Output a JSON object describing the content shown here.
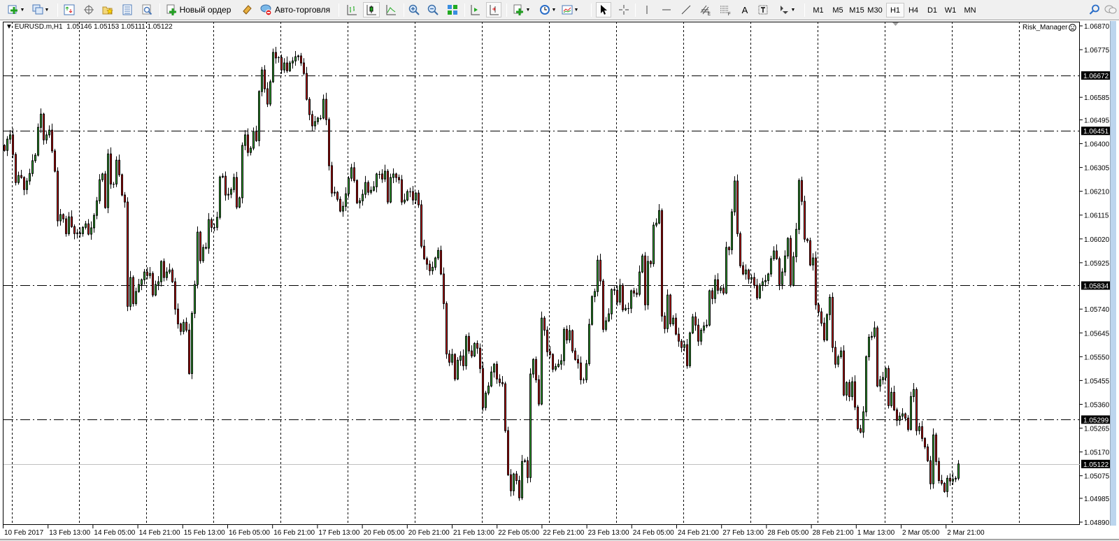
{
  "toolbar": {
    "new_order_label": "Новый ордер",
    "auto_trading_label": "Авто-торговля",
    "timeframes": [
      "M1",
      "M5",
      "M15",
      "M30",
      "H1",
      "H4",
      "D1",
      "W1",
      "MN"
    ],
    "active_timeframe": "H1",
    "text_tool_label": "A"
  },
  "chart": {
    "symbol_period": "EURUSD.m,H1",
    "open": "1.05146",
    "high": "1.05153",
    "low": "1.05111",
    "close": "1.05122",
    "indicator_label": "Risk_Manager"
  },
  "chart_data": {
    "type": "candlestick",
    "symbol": "EURUSD.m",
    "timeframe": "H1",
    "ylim": [
      1.0489,
      1.0687
    ],
    "price_ticks": [
      "1.06870",
      "1.06775",
      "1.06585",
      "1.06495",
      "1.06400",
      "1.06305",
      "1.06210",
      "1.06115",
      "1.06020",
      "1.05925",
      "1.05740",
      "1.05645",
      "1.05550",
      "1.05455",
      "1.05360",
      "1.05265",
      "1.05170",
      "1.05075",
      "1.04985",
      "1.04890"
    ],
    "time_labels": [
      "10 Feb 2017",
      "13 Feb 13:00",
      "14 Feb 05:00",
      "14 Feb 21:00",
      "15 Feb 13:00",
      "16 Feb 05:00",
      "16 Feb 21:00",
      "17 Feb 13:00",
      "20 Feb 05:00",
      "20 Feb 21:00",
      "21 Feb 13:00",
      "22 Feb 05:00",
      "22 Feb 21:00",
      "23 Feb 13:00",
      "24 Feb 05:00",
      "24 Feb 21:00",
      "27 Feb 13:00",
      "28 Feb 05:00",
      "28 Feb 21:00",
      "1 Mar 13:00",
      "2 Mar 05:00",
      "2 Mar 21:00"
    ],
    "bars_per_time_label": 16,
    "bars_per_grid_line": 24,
    "horizontal_lines": [
      "1.06672",
      "1.06451",
      "1.05834",
      "1.05299"
    ],
    "bid_line": "1.05122",
    "colors": {
      "bull": "#3cb93c",
      "bear": "#d81010",
      "outline": "#000000",
      "bid": "#c0c0c0",
      "level": "#000000"
    },
    "close": [
      1.06373,
      1.06418,
      1.06435,
      1.06357,
      1.06245,
      1.06273,
      1.06265,
      1.06217,
      1.06251,
      1.06281,
      1.06332,
      1.06354,
      1.06465,
      1.06518,
      1.06415,
      1.06435,
      1.06454,
      1.06371,
      1.0629,
      1.06092,
      1.06117,
      1.061,
      1.06041,
      1.06108,
      1.06069,
      1.06041,
      1.06044,
      1.06041,
      1.06066,
      1.0608,
      1.06039,
      1.06064,
      1.06114,
      1.06172,
      1.06256,
      1.06279,
      1.06145,
      1.06359,
      1.06239,
      1.06239,
      1.06334,
      1.06276,
      1.06195,
      1.06167,
      1.05751,
      1.05866,
      1.05762,
      1.0581,
      1.05838,
      1.05857,
      1.05888,
      1.05874,
      1.05882,
      1.05796,
      1.05838,
      1.05849,
      1.0593,
      1.05866,
      1.05888,
      1.05896,
      1.05849,
      1.0574,
      1.05681,
      1.05651,
      1.05687,
      1.05656,
      1.05483,
      1.05723,
      1.05838,
      1.06047,
      1.05933,
      1.05986,
      1.05983,
      1.06097,
      1.06066,
      1.06066,
      1.06106,
      1.06267,
      1.0627,
      1.06195,
      1.06198,
      1.06217,
      1.06265,
      1.06147,
      1.06184,
      1.06393,
      1.06435,
      1.06365,
      1.06382,
      1.06449,
      1.06412,
      1.06608,
      1.06694,
      1.06619,
      1.06558,
      1.06647,
      1.06764,
      1.06742,
      1.06744,
      1.06694,
      1.06722,
      1.06691,
      1.06722,
      1.0673,
      1.06747,
      1.0675,
      1.06722,
      1.0668,
      1.06577,
      1.06516,
      1.06471,
      1.06488,
      1.06502,
      1.06502,
      1.06577,
      1.06496,
      1.06312,
      1.06203,
      1.06206,
      1.06178,
      1.06131,
      1.0615,
      1.062,
      1.06262,
      1.06304,
      1.06253,
      1.06164,
      1.06172,
      1.06198,
      1.06245,
      1.06206,
      1.06214,
      1.06228,
      1.06279,
      1.06279,
      1.06259,
      1.0629,
      1.06167,
      1.06265,
      1.06279,
      1.06265,
      1.06256,
      1.06167,
      1.06175,
      1.06209,
      1.06209,
      1.06175,
      1.06203,
      1.06156,
      1.05991,
      1.05941,
      1.05919,
      1.05893,
      1.05907,
      1.05944,
      1.05974,
      1.0588,
      1.05762,
      1.05561,
      1.05528,
      1.05559,
      1.05461,
      1.05536,
      1.05553,
      1.05514,
      1.05631,
      1.05573,
      1.05553,
      1.05603,
      1.05584,
      1.05503,
      1.05347,
      1.05405,
      1.05433,
      1.05489,
      1.0552,
      1.05461,
      1.05447,
      1.05442,
      1.05255,
      1.05079,
      1.05015,
      1.05082,
      1.05056,
      1.04987,
      1.05132,
      1.05135,
      1.05068,
      1.05481,
      1.05539,
      1.05458,
      1.05361,
      1.05704,
      1.05656,
      1.0557,
      1.05559,
      1.055,
      1.05511,
      1.0552,
      1.05534,
      1.05659,
      1.05617,
      1.05654,
      1.05573,
      1.05539,
      1.05525,
      1.05458,
      1.05458,
      1.05522,
      1.05679,
      1.0579,
      1.0581,
      1.05935,
      1.05852,
      1.05659,
      1.05693,
      1.05721,
      1.05818,
      1.05815,
      1.05768,
      1.05835,
      1.05737,
      1.05743,
      1.05743,
      1.05813,
      1.05804,
      1.05799,
      1.05888,
      1.05952,
      1.05757,
      1.0593,
      1.05921,
      1.06075,
      1.06083,
      1.06133,
      1.05712,
      1.05662,
      1.05796,
      1.05681,
      1.05704,
      1.0564,
      1.05612,
      1.05587,
      1.05598,
      1.05514,
      1.05645,
      1.05709,
      1.05676,
      1.05612,
      1.05656,
      1.05673,
      1.05676,
      1.05813,
      1.05782,
      1.05857,
      1.05815,
      1.05824,
      1.05804,
      1.05986,
      1.05977,
      1.06128,
      1.06251,
      1.06041,
      1.05913,
      1.0588,
      1.05896,
      1.0586,
      1.05866,
      1.05835,
      1.05785,
      1.05835,
      1.05849,
      1.05854,
      1.0588,
      1.05941,
      1.05972,
      1.05941,
      1.05838,
      1.05888,
      1.05952,
      1.06022,
      1.05835,
      1.05949,
      1.06058,
      1.06253,
      1.0617,
      1.06019,
      1.06013,
      1.05916,
      1.05944,
      1.05757,
      1.05729,
      1.05684,
      1.05617,
      1.05718,
      1.05787,
      1.05587,
      1.0552,
      1.0555,
      1.05573,
      1.05397,
      1.05447,
      1.05391,
      1.0545,
      1.05349,
      1.05263,
      1.05249,
      1.0533,
      1.0555,
      1.05628,
      1.05631,
      1.05665,
      1.05433,
      1.05458,
      1.05467,
      1.05503,
      1.05355,
      1.05408,
      1.05338,
      1.05296,
      1.05313,
      1.05322,
      1.05305,
      1.0526,
      1.05391,
      1.05419,
      1.05255,
      1.05271,
      1.05224,
      1.0519,
      1.05135,
      1.05043,
      1.05238,
      1.05132,
      1.05056,
      1.05045,
      1.05012,
      1.05065,
      1.05054,
      1.05062,
      1.05065,
      1.05122
    ]
  }
}
